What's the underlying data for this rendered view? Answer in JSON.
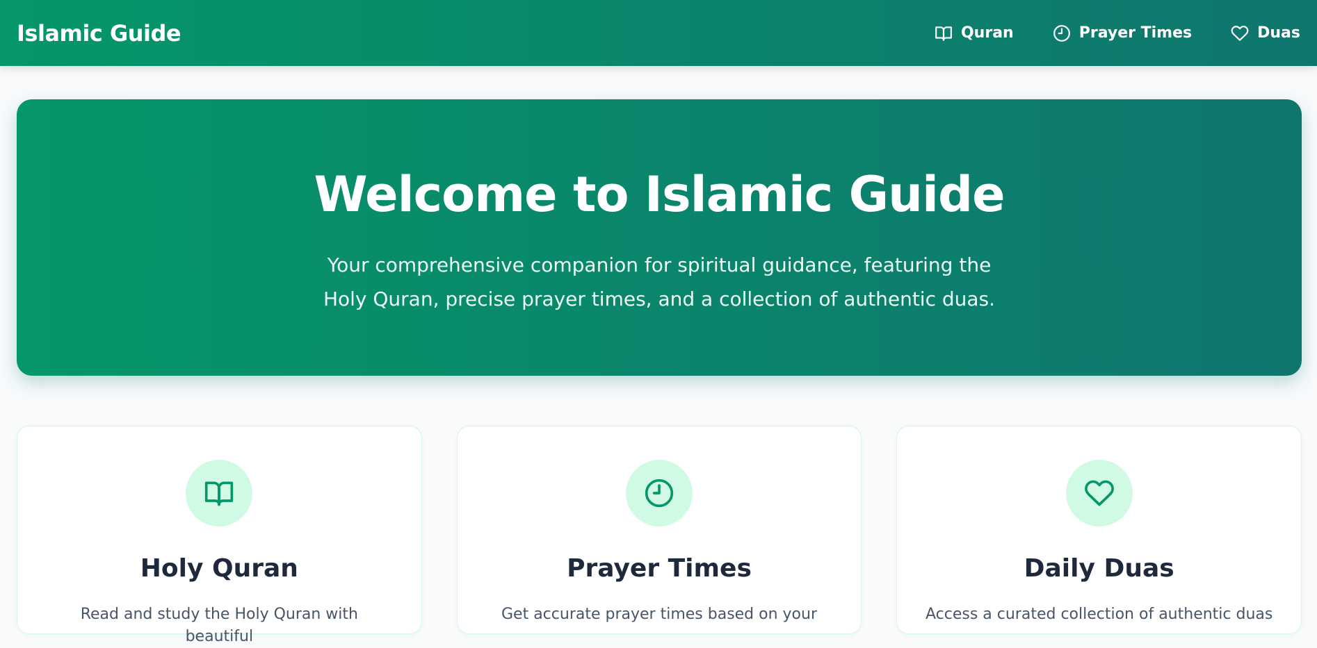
{
  "navbar": {
    "brand": "Islamic Guide",
    "links": [
      {
        "label": "Quran",
        "icon": "book-icon"
      },
      {
        "label": "Prayer Times",
        "icon": "clock-icon"
      },
      {
        "label": "Duas",
        "icon": "heart-icon"
      }
    ]
  },
  "hero": {
    "title": "Welcome to Islamic Guide",
    "subtitle": "Your comprehensive companion for spiritual guidance, featuring the Holy Quran, precise prayer times, and a collection of authentic duas."
  },
  "cards": [
    {
      "title": "Holy Quran",
      "description": "Read and study the Holy Quran with beautiful",
      "icon": "book-icon"
    },
    {
      "title": "Prayer Times",
      "description": "Get accurate prayer times based on your",
      "icon": "clock-icon"
    },
    {
      "title": "Daily Duas",
      "description": "Access a curated collection of authentic duas",
      "icon": "heart-icon"
    }
  ],
  "colors": {
    "primary": "#059669",
    "primary_dark": "#0f766e",
    "icon_bg": "#d1fae5",
    "title_text": "#1e293b"
  }
}
